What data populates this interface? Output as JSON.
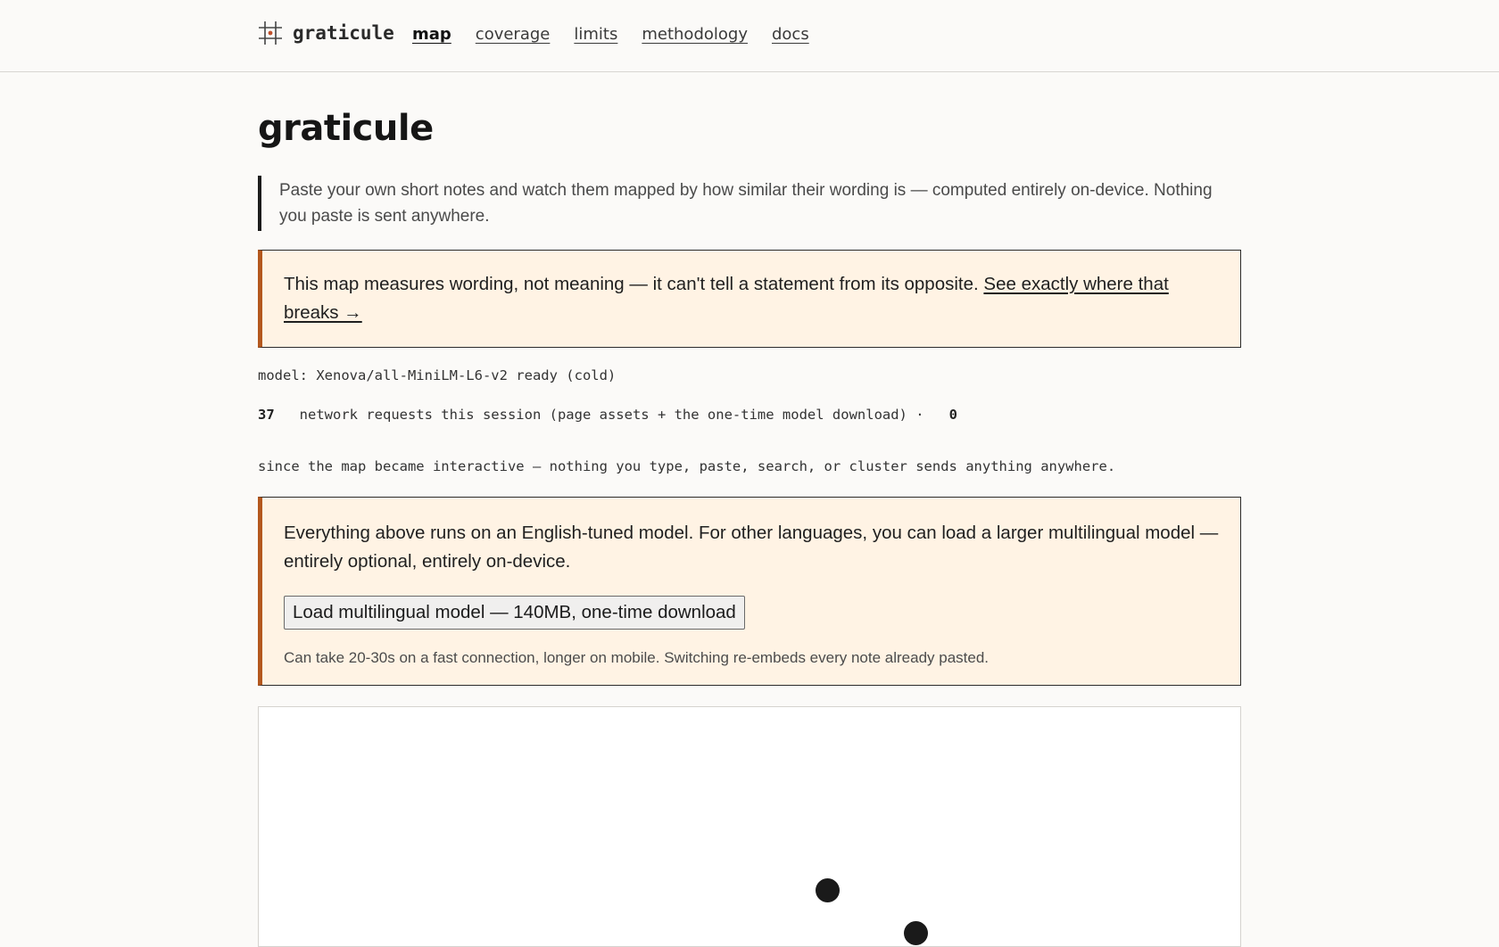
{
  "brand": {
    "name": "graticule"
  },
  "nav": {
    "items": [
      {
        "label": "map",
        "active": true
      },
      {
        "label": "coverage"
      },
      {
        "label": "limits"
      },
      {
        "label": "methodology"
      },
      {
        "label": "docs"
      }
    ]
  },
  "page": {
    "title": "graticule",
    "lede": "Paste your own short notes and watch them mapped by how similar their wording is — computed entirely on-device. Nothing you paste is sent anywhere."
  },
  "callout_one": {
    "text": "This map measures wording, not meaning — it can't tell a statement from its opposite. ",
    "link": "See exactly where that breaks →"
  },
  "status": {
    "model_line": "model: Xenova/all-MiniLM-L6-v2 ready (cold)",
    "request_count": "37",
    "request_text": "network requests this session (page assets + the one-time model download) ·",
    "interactive_count": "0",
    "since_line": "since the map became interactive — nothing you type, paste, search, or cluster sends anything anywhere."
  },
  "callout_two": {
    "text": "Everything above runs on an English-tuned model. For other languages, you can load a larger multilingual model — entirely optional, entirely on-device.",
    "button_label": "Load multilingual model — 140MB, one-time download",
    "note": "Can take 20-30s on a fast connection, longer on mobile. Switching re-embeds every note already pasted."
  },
  "colors": {
    "accent": "#b4581e",
    "callout_bg": "#fff3e4",
    "page_bg": "#fbfaf8",
    "brand_dot": "#c0502b"
  },
  "icons": {
    "brand": "graticule-grid-icon"
  }
}
